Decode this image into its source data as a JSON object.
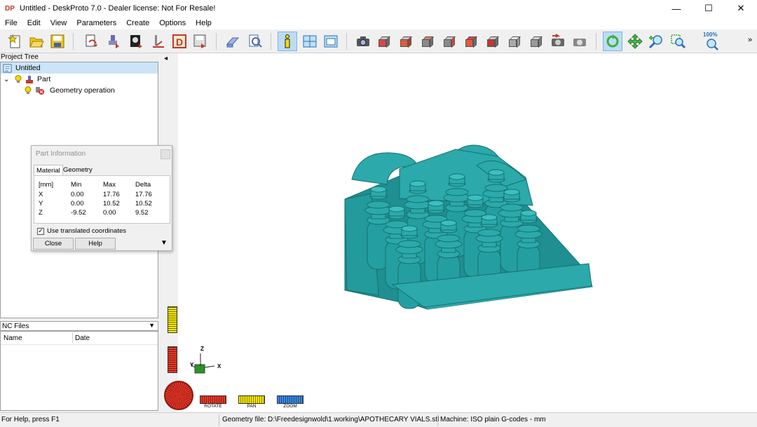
{
  "window": {
    "logo_text": "DP",
    "title": "Untitled - DeskProto 7.0 - Dealer license: Not For Resale!",
    "minimize": "—",
    "maximize": "☐",
    "close": "✕"
  },
  "menu": [
    "File",
    "Edit",
    "View",
    "Parameters",
    "Create",
    "Options",
    "Help"
  ],
  "toolbar": {
    "overflow": "»",
    "zoom_percent": "100%"
  },
  "project_tree": {
    "header": "Project Tree",
    "root": "Untitled",
    "part": "Part",
    "operation": "Geometry operation",
    "expander": "⌄"
  },
  "part_info": {
    "title": "Part Information",
    "tabs": [
      "Material",
      "Geometry"
    ],
    "headers": [
      "[mm]",
      "Min",
      "Max",
      "Delta"
    ],
    "rows": [
      [
        "X",
        "0.00",
        "17.76",
        "17.76"
      ],
      [
        "Y",
        "0.00",
        "10.52",
        "10.52"
      ],
      [
        "Z",
        "-9.52",
        "0.00",
        "9.52"
      ]
    ],
    "checkbox_label": "Use translated coordinates",
    "checkbox_checked": true,
    "check_mark": "✓",
    "close_button": "Close",
    "help_button": "Help",
    "dropdown_arrow": "▼"
  },
  "nc_files": {
    "header": "NC Files",
    "dropdown_arrow": "▼",
    "columns": [
      "Name",
      "Date"
    ]
  },
  "viewport": {
    "collapse_arrow": "◂",
    "model_color": "#2ba9ab",
    "axes": {
      "x": "X",
      "y": "Y",
      "z": "Z"
    },
    "nav_buttons": [
      "ROTATE",
      "PAN",
      "ZOOM"
    ]
  },
  "status": {
    "help": "For Help, press F1",
    "geometry_file": "Geometry file: D:\\Freedesignwold\\1.working\\APOTHECARY VIALS.stl",
    "machine": "Machine: ISO plain G-codes - mm"
  }
}
